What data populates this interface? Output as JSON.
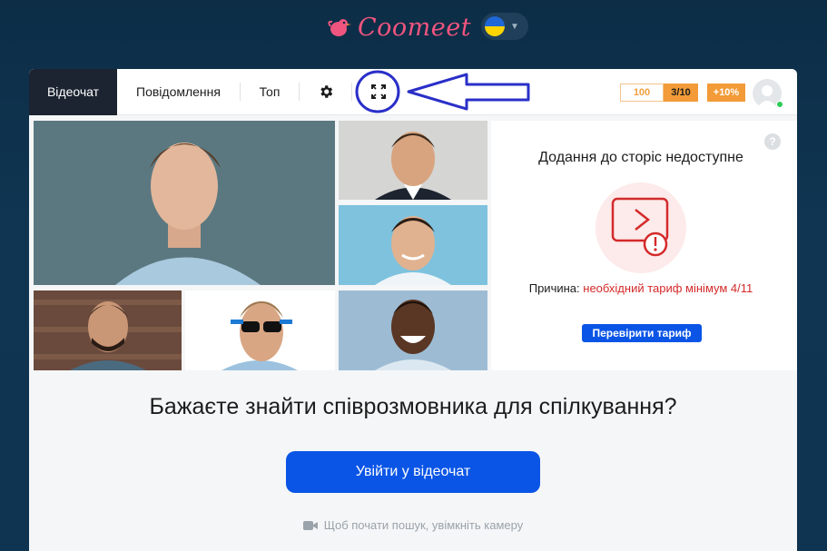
{
  "brand": {
    "name": "Coomeet",
    "color": "#f0557f"
  },
  "language": {
    "flag": "ukraine-flag-icon"
  },
  "navbar": {
    "tabs": [
      {
        "label": "Відеочат",
        "active": true
      },
      {
        "label": "Повідомлення",
        "active": false
      },
      {
        "label": "Топ",
        "active": false
      }
    ],
    "settings_icon": "gear-icon",
    "fullscreen_icon": "expand-icon"
  },
  "counters": {
    "balance": "100",
    "progress": "3/10",
    "bonus": "+10%"
  },
  "stories": {
    "title": "Додання до сторіс недоступне",
    "help": "?",
    "reason_label": "Причина:",
    "reason_text": "необхідний тариф мінімум 4/11",
    "button": "Перевірити тариф"
  },
  "cta": {
    "title": "Бажаєте знайти співрозмовника для спілкування?",
    "button": "Увійти у відеочат",
    "hint": "Щоб почати пошук, увімкніть камеру"
  },
  "colors": {
    "accent": "#0a55e6",
    "warning": "#d42a2a",
    "orange": "#f29b38",
    "annotation": "#2a2fc8"
  }
}
